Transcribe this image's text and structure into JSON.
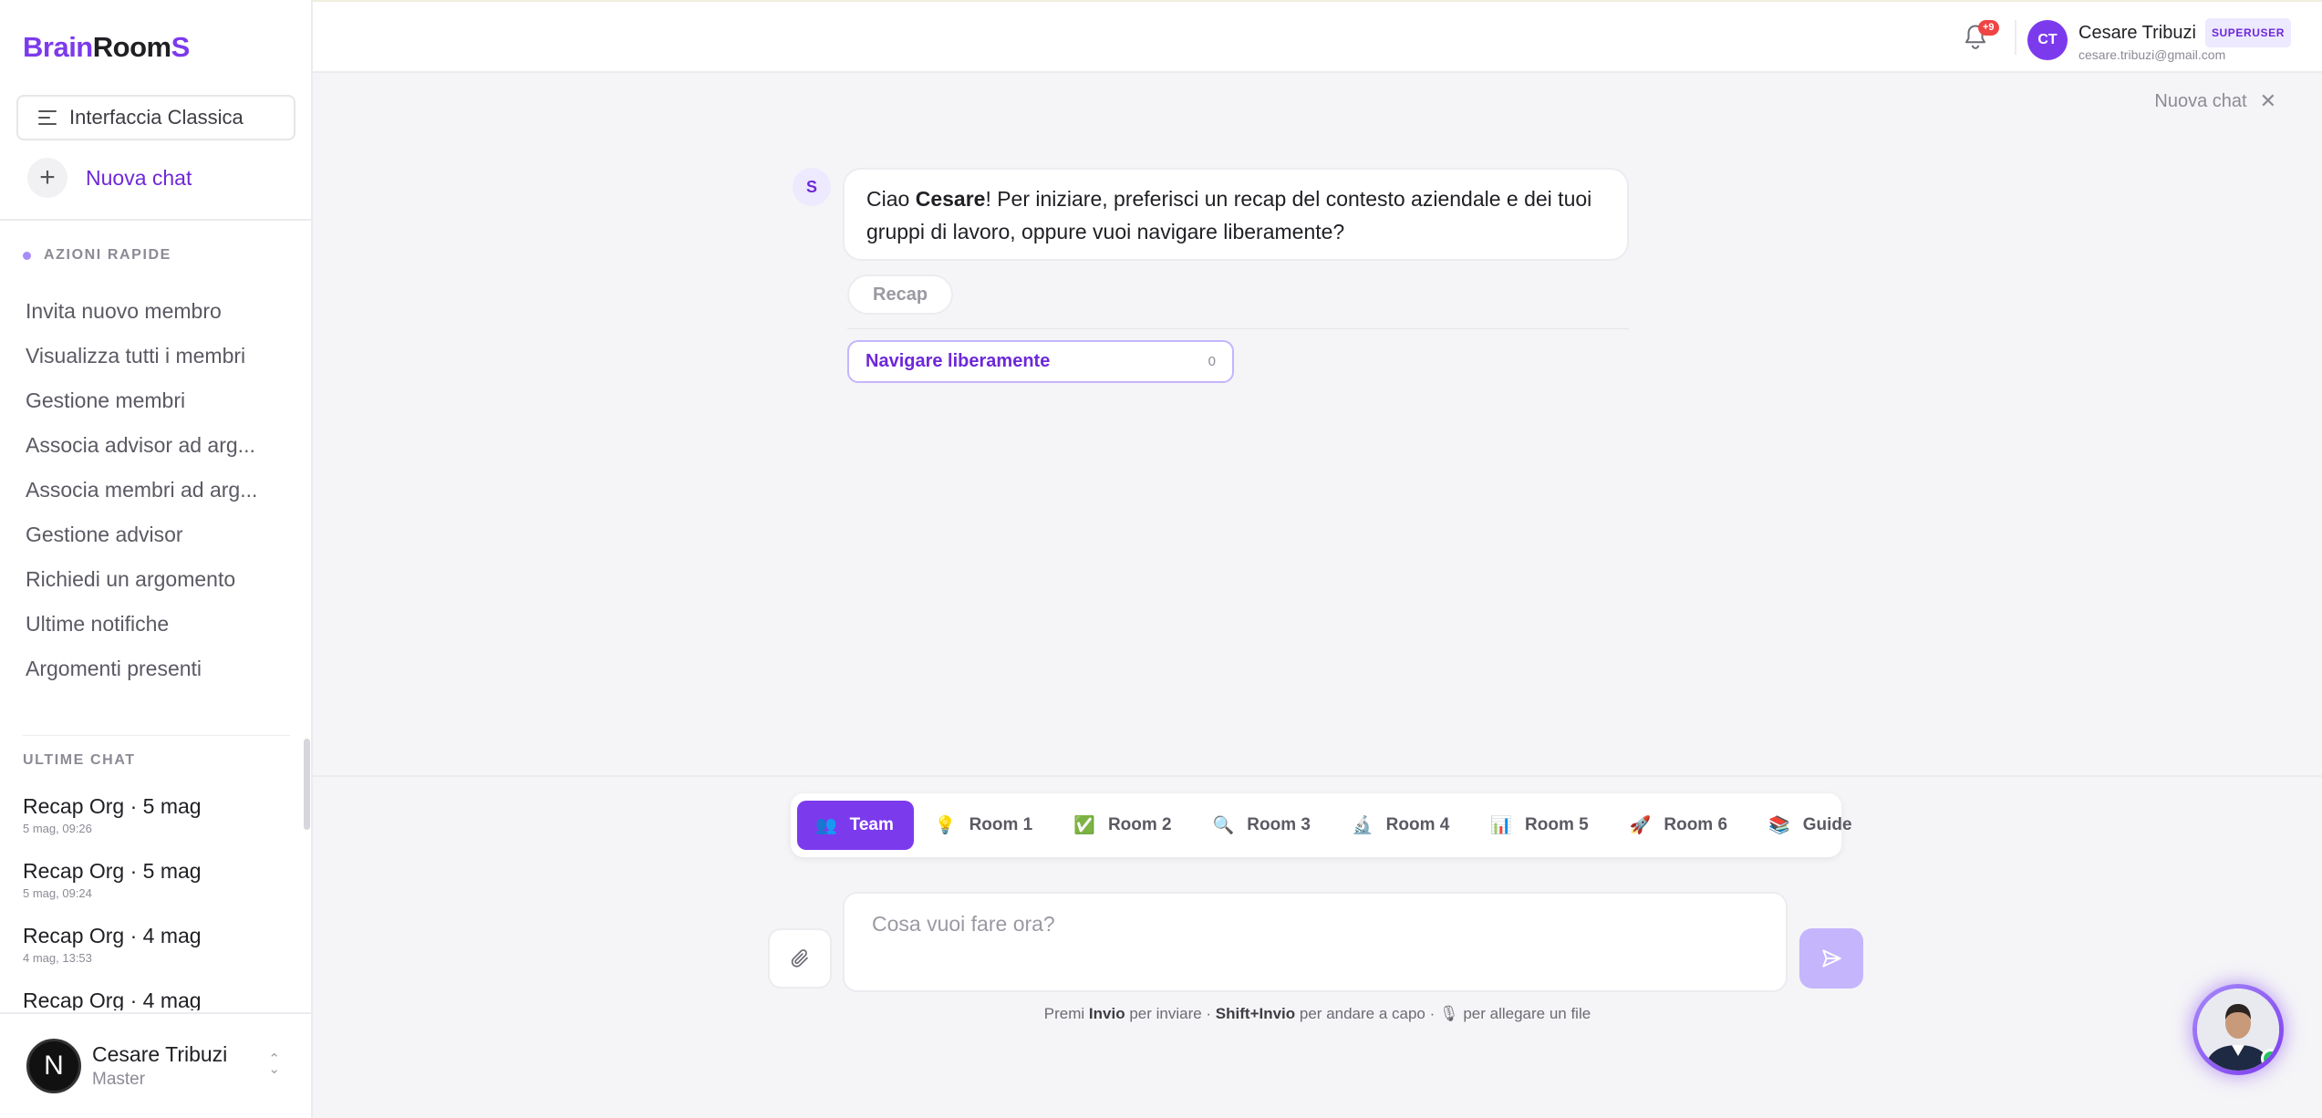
{
  "brand": {
    "part1": "Brain",
    "part2": "Room",
    "part3": "S"
  },
  "sidebar": {
    "classic_label": "Interfaccia Classica",
    "new_chat_label": "Nuova chat",
    "quick_actions_title": "AZIONI RAPIDE",
    "quick_actions": [
      "Invita nuovo membro",
      "Visualizza tutti i membri",
      "Gestione membri",
      "Associa advisor ad arg...",
      "Associa membri ad arg...",
      "Gestione advisor",
      "Richiedi un argomento",
      "Ultime notifiche",
      "Argomenti presenti"
    ],
    "recent_title": "ULTIME CHAT",
    "recent_chats": [
      {
        "title": "Recap Org · 5 mag",
        "date": "5 mag, 09:26"
      },
      {
        "title": "Recap Org · 5 mag",
        "date": "5 mag, 09:24"
      },
      {
        "title": "Recap Org · 4 mag",
        "date": "4 mag, 13:53"
      },
      {
        "title": "Recap Org · 4 mag",
        "date": ""
      }
    ],
    "user": {
      "initial": "N",
      "name": "Cesare Tribuzi",
      "role": "Master"
    }
  },
  "topbar": {
    "notif_count": "+9",
    "user_initials": "CT",
    "user_name": "Cesare Tribuzi",
    "user_badge": "SUPERUSER",
    "user_email": "cesare.tribuzi@gmail.com"
  },
  "chat": {
    "close_label": "Nuova chat",
    "assistant_initial": "S",
    "message_pre": "Ciao ",
    "message_name": "Cesare",
    "message_post": "! Per iniziare, preferisci un recap del contesto aziendale e dei tuoi gruppi di lavoro, oppure vuoi navigare liberamente?",
    "option_recap": "Recap",
    "option_nav": "Navigare liberamente",
    "option_nav_count": "0"
  },
  "rooms": [
    {
      "icon": "👥",
      "label": "Team",
      "active": true
    },
    {
      "icon": "💡",
      "label": "Room 1"
    },
    {
      "icon": "✅",
      "label": "Room 2"
    },
    {
      "icon": "🔍",
      "label": "Room 3"
    },
    {
      "icon": "🔬",
      "label": "Room 4"
    },
    {
      "icon": "📊",
      "label": "Room 5"
    },
    {
      "icon": "🚀",
      "label": "Room 6"
    },
    {
      "icon": "📚",
      "label": "Guide"
    }
  ],
  "composer": {
    "placeholder": "Cosa vuoi fare ora?",
    "hint_k1": "Invio",
    "hint_t1": " per inviare · ",
    "hint_k2": "Shift+Invio",
    "hint_t2": " per andare a capo · ",
    "hint_icon": "🎙",
    "hint_t3": " per allegare un file",
    "hint_pre": "Premi "
  },
  "colors": {
    "accent": "#7c3aed",
    "accent_light": "#c4b5fd",
    "badge_red": "#ef4444",
    "online": "#22c55e"
  }
}
